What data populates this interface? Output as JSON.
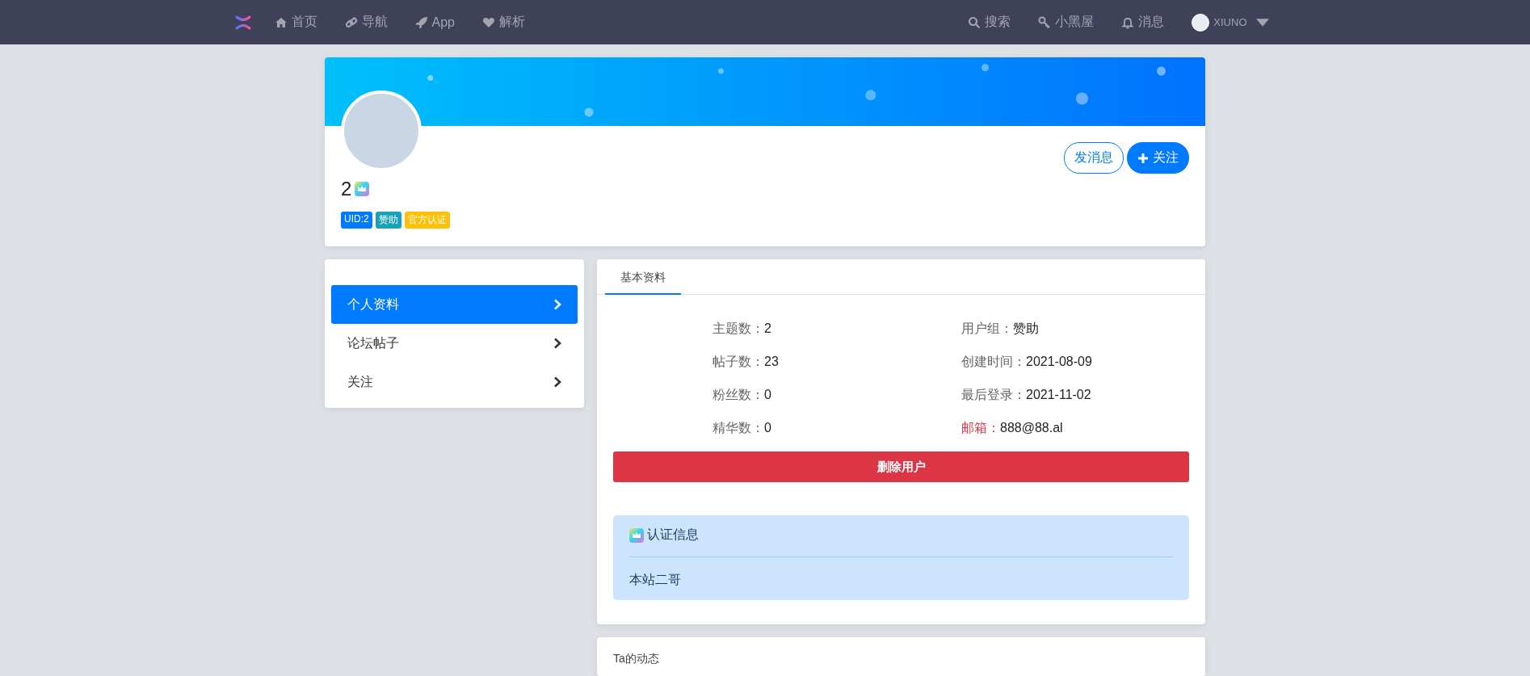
{
  "navbar": {
    "left_items": [
      {
        "label": "首页"
      },
      {
        "label": "导航"
      },
      {
        "label": "App"
      },
      {
        "label": "解析"
      }
    ],
    "right_items": [
      {
        "label": "搜索"
      },
      {
        "label": "小黑屋"
      },
      {
        "label": "消息"
      }
    ],
    "user": {
      "name": "XIUNO"
    }
  },
  "profile": {
    "name": "2",
    "badges": [
      {
        "label": "UID:2",
        "color": "#007bff"
      },
      {
        "label": "赞助",
        "color": "#17a2b8"
      },
      {
        "label": "官方认证",
        "color": "#ffc107"
      }
    ],
    "buttons": [
      {
        "label": "发消息",
        "kind": "outline"
      },
      {
        "label": "关注",
        "kind": "primary"
      }
    ]
  },
  "sidebar": {
    "items": [
      {
        "label": "个人资料",
        "selected": true
      },
      {
        "label": "论坛帖子",
        "selected": false
      },
      {
        "label": "关注",
        "selected": false
      }
    ]
  },
  "tabs": [
    {
      "label": "基本资料",
      "selected": true
    }
  ],
  "info": [
    {
      "label": "主题数：",
      "value": "2",
      "highlighted": false
    },
    {
      "label": "用户组：",
      "value": "赞助",
      "highlighted": false
    },
    {
      "label": "帖子数：",
      "value": "23",
      "highlighted": false
    },
    {
      "label": "创建时间：",
      "value": "2021-08-09",
      "highlighted": false
    },
    {
      "label": "粉丝数：",
      "value": "0",
      "highlighted": false
    },
    {
      "label": "最后登录：",
      "value": "2021-11-02",
      "highlighted": false
    },
    {
      "label": "精华数：",
      "value": "0",
      "highlighted": false
    },
    {
      "label": "邮箱：",
      "value": "888@88.al",
      "highlighted": true
    }
  ],
  "delete_button": "删除用户",
  "certification": {
    "title": "认证信息",
    "text": "本站二哥"
  },
  "activity": {
    "title": "Ta的动态"
  }
}
